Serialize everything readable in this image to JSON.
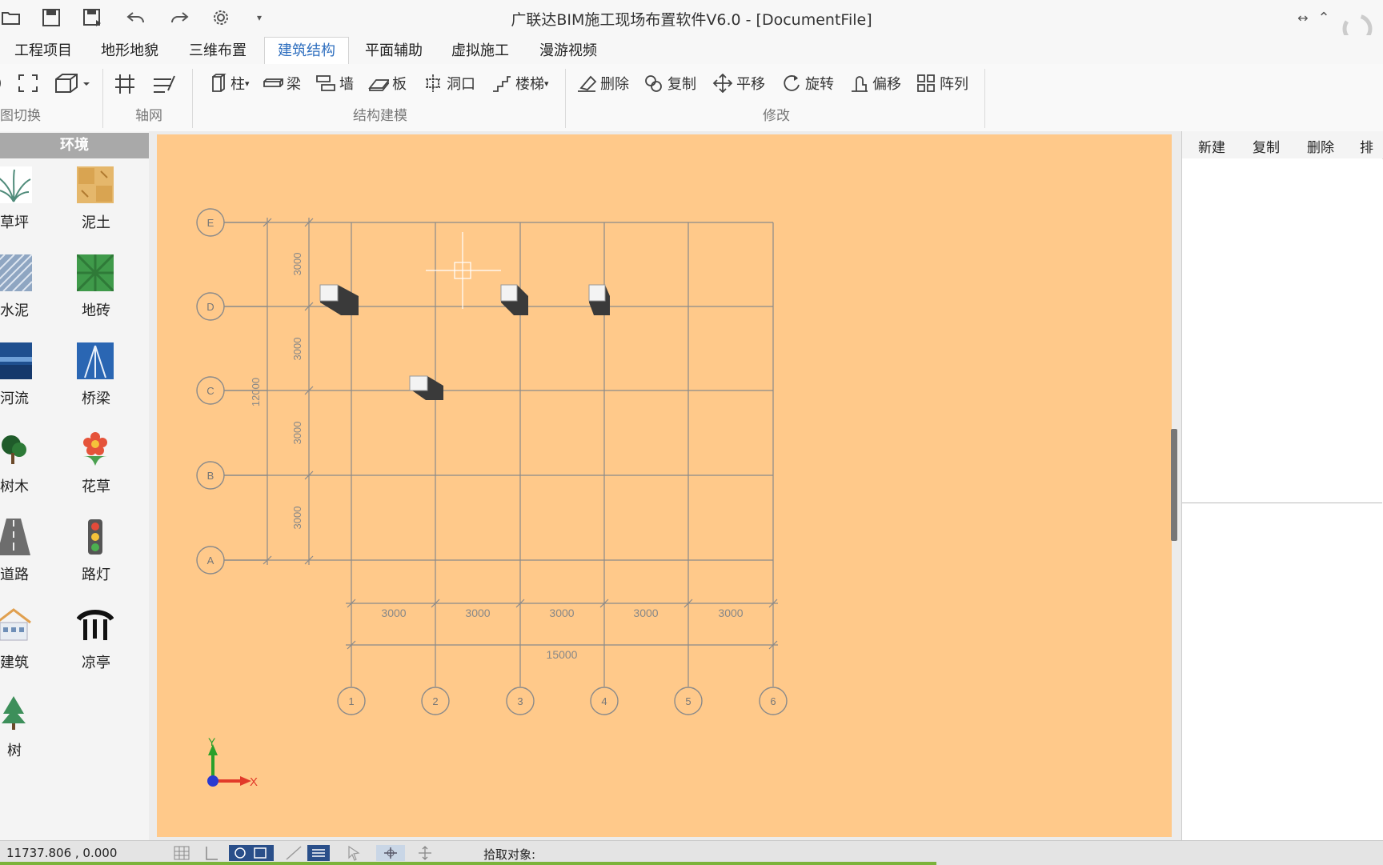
{
  "window": {
    "title": "广联达BIM施工现场布置软件V6.0 - [DocumentFile]"
  },
  "menu": {
    "tabs": [
      {
        "label": "工程项目"
      },
      {
        "label": "地形地貌"
      },
      {
        "label": "三维布置"
      },
      {
        "label": "建筑结构",
        "active": true
      },
      {
        "label": "平面辅助"
      },
      {
        "label": "虚拟施工"
      },
      {
        "label": "漫游视频"
      }
    ]
  },
  "ribbon": {
    "groups": {
      "view_switch": "图切换",
      "axis_grid": "轴网",
      "structure_modeling": "结构建模",
      "modify": "修改"
    },
    "structure": {
      "column": "柱",
      "beam": "梁",
      "wall": "墙",
      "slab": "板",
      "opening": "洞口",
      "stairs": "楼梯"
    },
    "modify": {
      "delete": "删除",
      "copy": "复制",
      "move": "平移",
      "rotate": "旋转",
      "offset": "偏移",
      "array": "阵列"
    }
  },
  "left_panel": {
    "header": "环境",
    "items": [
      {
        "label": "草坪",
        "icon": "grass-icon"
      },
      {
        "label": "泥土",
        "icon": "soil-icon"
      },
      {
        "label": "水泥",
        "icon": "cement-icon"
      },
      {
        "label": "地砖",
        "icon": "floor-tile-icon"
      },
      {
        "label": "河流",
        "icon": "river-icon"
      },
      {
        "label": "桥梁",
        "icon": "bridge-icon"
      },
      {
        "label": "树木",
        "icon": "trees-icon"
      },
      {
        "label": "花草",
        "icon": "flower-icon"
      },
      {
        "label": "道路",
        "icon": "road-icon"
      },
      {
        "label": "路灯",
        "icon": "traffic-light-icon"
      },
      {
        "label": "建筑",
        "icon": "building-icon"
      },
      {
        "label": "凉亭",
        "icon": "pavilion-icon"
      },
      {
        "label": "树",
        "icon": "tree-icon"
      }
    ]
  },
  "drawing": {
    "row_axes": [
      "E",
      "D",
      "C",
      "B",
      "A"
    ],
    "col_axes": [
      "1",
      "2",
      "3",
      "4",
      "5",
      "6"
    ],
    "row_spacing_label": "3000",
    "col_spacing_label": "3000",
    "total_height_label": "12000",
    "total_width_label": "15000",
    "axis_x": "X",
    "axis_y": "Y",
    "colors": {
      "background": "#ffc98a",
      "grid": "#8a8a8a"
    }
  },
  "right_panel": {
    "buttons": [
      "新建",
      "复制",
      "删除",
      "排序"
    ]
  },
  "status": {
    "coords": "11737.806 , 0.000",
    "pick_label": "拾取对象:"
  }
}
